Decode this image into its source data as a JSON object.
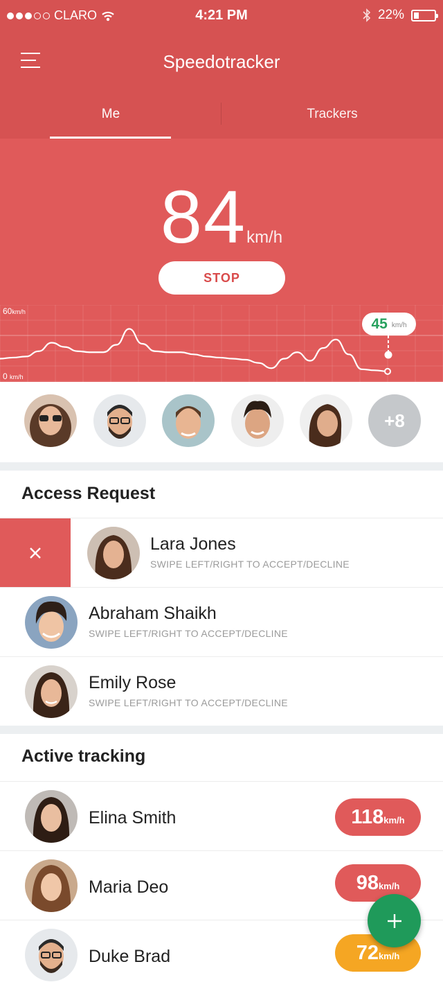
{
  "status_bar": {
    "carrier": "CLARO",
    "time": "4:21 PM",
    "battery": "22%"
  },
  "app": {
    "title": "Speedotracker"
  },
  "tabs": [
    {
      "label": "Me"
    },
    {
      "label": "Trackers"
    }
  ],
  "speed": {
    "value": "84",
    "unit": "km/h",
    "stop_label": "STOP"
  },
  "chart": {
    "y_max_label": "60",
    "y_min_label": "0",
    "unit": "km/h",
    "current": {
      "value": "45",
      "unit": "km/h"
    }
  },
  "chart_data": {
    "type": "line",
    "ylim": [
      0,
      60
    ],
    "x": [
      0,
      1,
      2,
      3,
      4,
      5,
      6,
      7,
      8,
      9,
      10,
      11,
      12,
      13,
      14,
      15,
      16,
      17,
      18,
      19,
      20,
      21,
      22,
      23,
      24,
      25,
      26,
      27,
      28,
      29,
      30
    ],
    "values": [
      16,
      17,
      18,
      23,
      31,
      27,
      23,
      22,
      22,
      29,
      44,
      30,
      23,
      22,
      22,
      20,
      18,
      17,
      16,
      15,
      12,
      7,
      16,
      22,
      14,
      26,
      34,
      20,
      6,
      5,
      4
    ],
    "current_value": 45,
    "unit": "km/h"
  },
  "avatars": {
    "more_label": "+8"
  },
  "access_request": {
    "title": "Access Request",
    "items": [
      {
        "name": "Lara Jones",
        "hint": "SWIPE LEFT/RIGHT TO ACCEPT/DECLINE"
      },
      {
        "name": "Abraham Shaikh",
        "hint": "SWIPE LEFT/RIGHT TO ACCEPT/DECLINE"
      },
      {
        "name": "Emily Rose",
        "hint": "SWIPE LEFT/RIGHT TO ACCEPT/DECLINE"
      }
    ]
  },
  "active_tracking": {
    "title": "Active tracking",
    "items": [
      {
        "name": "Elina Smith",
        "speed": "118",
        "unit": "km/h",
        "color": "#e05a5a"
      },
      {
        "name": "Maria Deo",
        "speed": "98",
        "unit": "km/h",
        "color": "#e05a5a"
      },
      {
        "name": "Duke Brad",
        "speed": "72",
        "unit": "km/h",
        "color": "#f5a623"
      }
    ]
  },
  "colors": {
    "header": "#d65252",
    "hero": "#e05a5a",
    "fab": "#1f9a5a",
    "accent_green": "#27a15e"
  },
  "icons": {
    "menu": "hamburger-icon",
    "decline": "close-icon",
    "fab": "plus-icon"
  }
}
